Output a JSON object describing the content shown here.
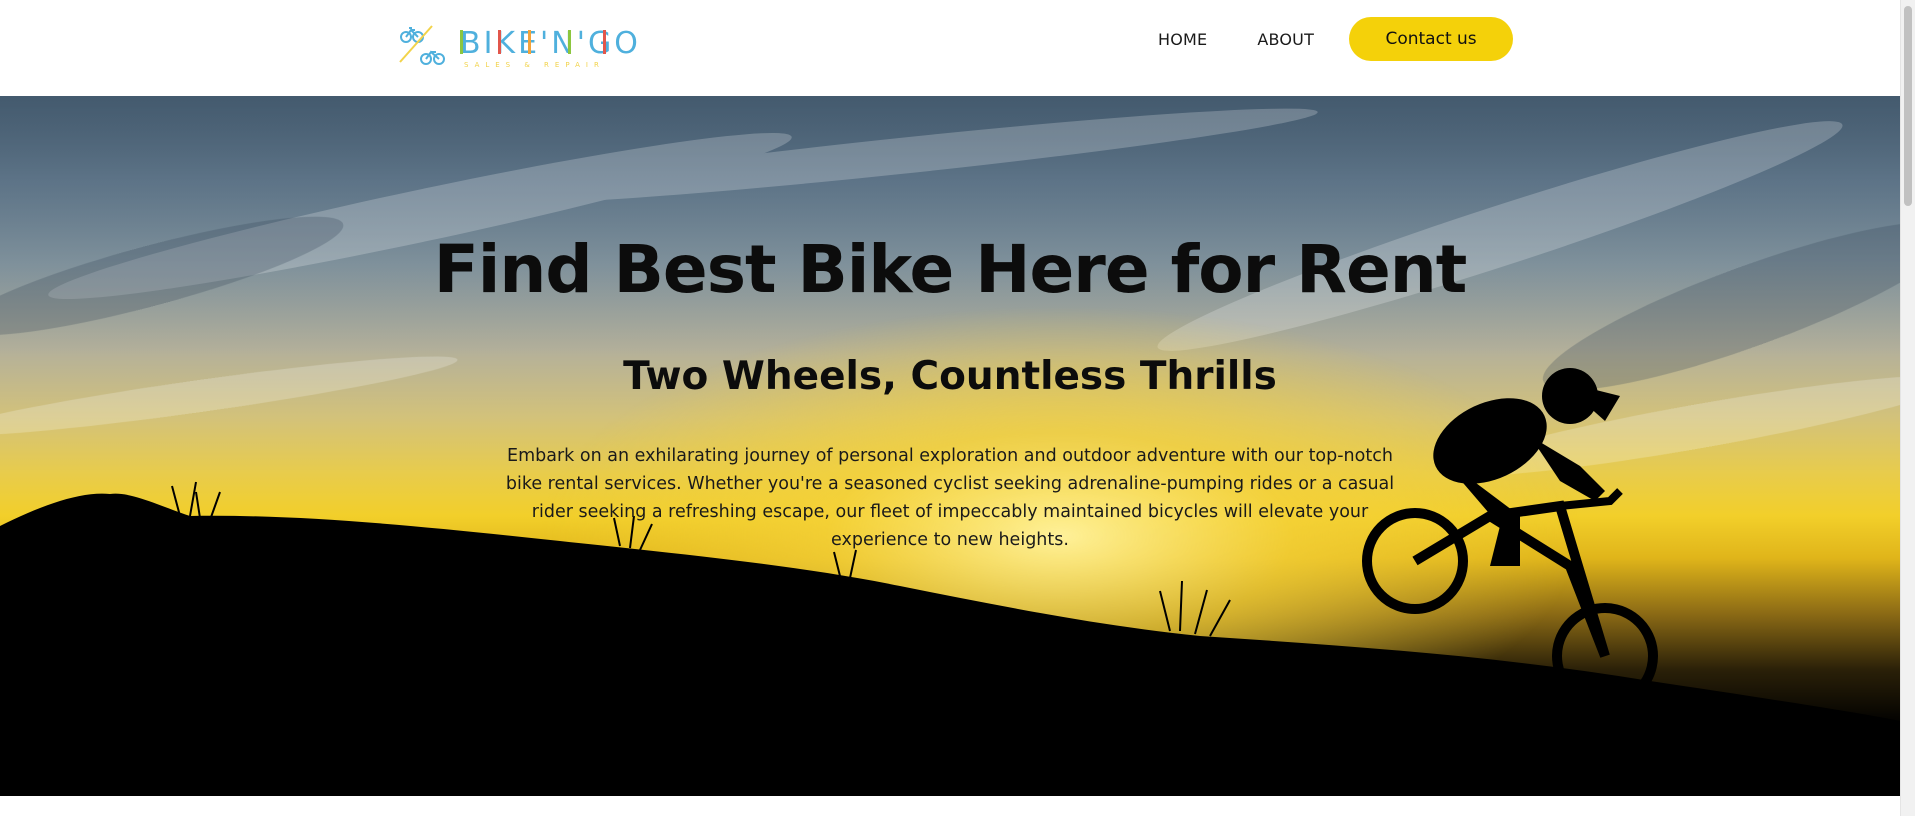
{
  "brand": {
    "name": "BIKE'N'GO",
    "tagline": "SALES & REPAIR",
    "colors": {
      "accent_yellow": "#f4d10a",
      "logo_blue": "#4fb0dd",
      "logo_green": "#8cc63f",
      "logo_red": "#e2564b",
      "logo_orange": "#f2a33a"
    }
  },
  "nav": {
    "items": [
      {
        "label": "HOME"
      },
      {
        "label": "ABOUT"
      }
    ],
    "cta_label": "Contact us"
  },
  "hero": {
    "title": "Find Best Bike Here for Rent",
    "subtitle": "Two Wheels, Countless Thrills",
    "description": "Embark on an exhilarating journey of personal exploration and outdoor adventure with our top-notch bike rental services. Whether you're a seasoned cyclist seeking adrenaline-pumping rides or a casual rider seeking a refreshing escape, our fleet of impeccably maintained bicycles will elevate your experience to new heights.",
    "background": "sunset-mountain-biker-silhouette"
  }
}
